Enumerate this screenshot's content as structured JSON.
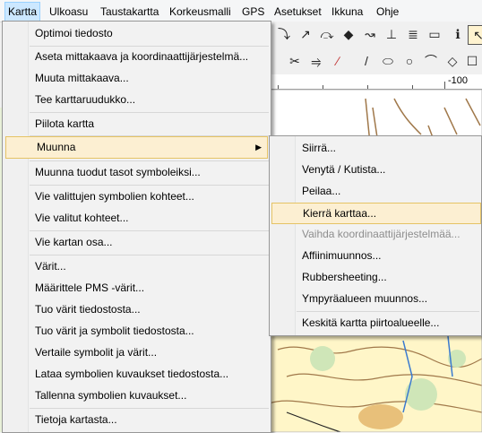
{
  "menubar": {
    "items": [
      "Kartta",
      "Ulkoasu",
      "Taustakartta",
      "Korkeusmalli",
      "GPS",
      "Asetukset",
      "Ikkuna",
      "Ohje"
    ]
  },
  "ruler": {
    "label": "-100"
  },
  "main_menu": {
    "items": [
      "Optimoi tiedosto",
      "Aseta mittakaava ja koordinaattijärjestelmä...",
      "Muuta mittakaava...",
      "Tee karttaruudukko...",
      "Piilota kartta",
      "Muunna",
      "Muunna tuodut tasot symboleiksi...",
      "Vie valittujen symbolien kohteet...",
      "Vie valitut kohteet...",
      "Vie kartan osa...",
      "Värit...",
      "Määrittele PMS -värit...",
      "Tuo värit tiedostosta...",
      "Tuo värit ja symbolit tiedostosta...",
      "Vertaile symbolit ja värit...",
      "Lataa symbolien kuvaukset tiedostosta...",
      "Tallenna symbolien kuvaukset...",
      "Tietoja kartasta..."
    ],
    "submenu_arrow": "▶"
  },
  "submenu": {
    "items": [
      "Siirrä...",
      "Venytä / Kutista...",
      "Peilaa...",
      "Kierrä karttaa...",
      "Vaihda koordinaattijärjestelmää...",
      "Affiinimuunnos...",
      "Rubbersheeting...",
      "Ympyräalueen muunnos...",
      "Keskitä kartta piirtoalueelle..."
    ]
  },
  "colors": {
    "highlight": "#fcefd2",
    "highlight_border": "#e5c365",
    "active_menu": "#cce8ff"
  }
}
